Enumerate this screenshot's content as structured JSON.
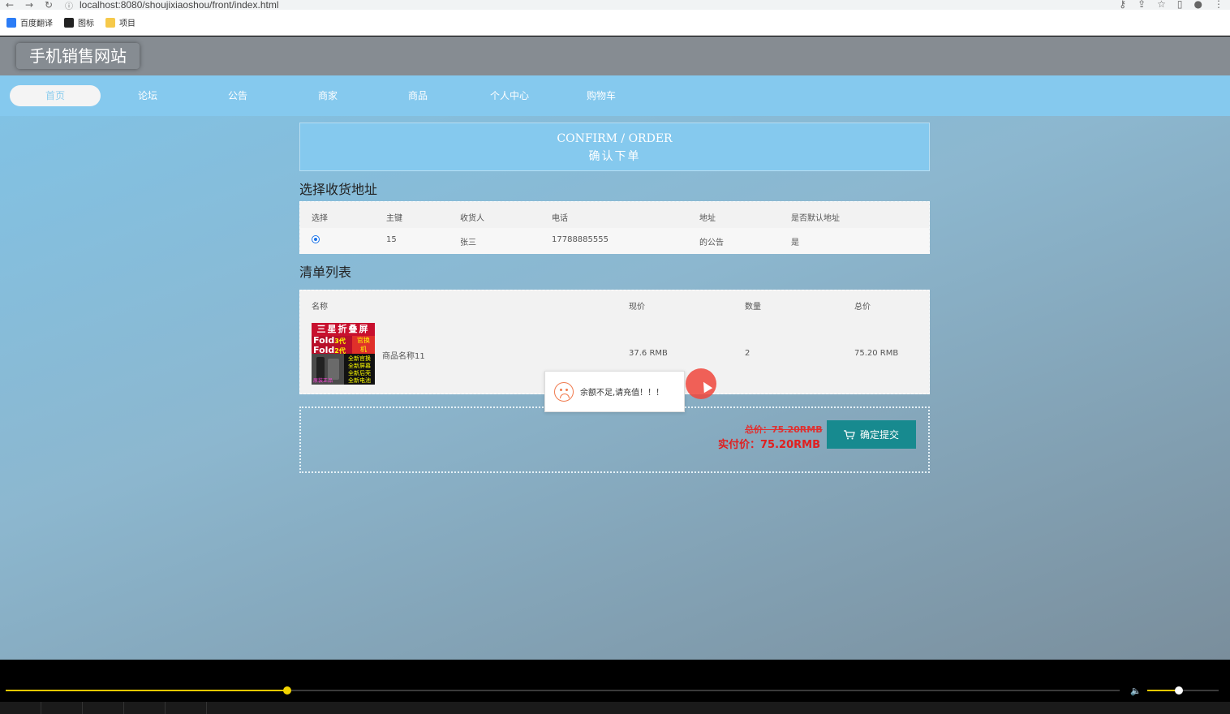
{
  "browser": {
    "url": "localhost:8080/shoujixiaoshou/front/index.html",
    "bookmarks": [
      {
        "label": "百度翻译",
        "icon": "translate-icon",
        "color": "#2b7cf6"
      },
      {
        "label": "图标",
        "icon": "image-icon",
        "color": "#222222"
      },
      {
        "label": "项目",
        "icon": "folder-icon",
        "color": "#f6c94a"
      }
    ]
  },
  "site": {
    "logo": "手机销售网站",
    "nav": [
      "首页",
      "论坛",
      "公告",
      "商家",
      "商品",
      "个人中心",
      "购物车"
    ],
    "active_nav": "首页"
  },
  "confirm": {
    "title_en": "CONFIRM / ORDER",
    "title_cn": "确认下单"
  },
  "address": {
    "section_title": "选择收货地址",
    "headers": [
      "选择",
      "主键",
      "收货人",
      "电话",
      "地址",
      "是否默认地址"
    ],
    "rows": [
      {
        "selected": true,
        "id": "15",
        "name": "张三",
        "phone": "17788885555",
        "address": "的公告",
        "default": "是"
      }
    ]
  },
  "order_list": {
    "section_title": "清单列表",
    "headers": [
      "名称",
      "现价",
      "数量",
      "总价"
    ],
    "items": [
      {
        "name": "商品名称11",
        "price": "37.6 RMB",
        "quantity": "2",
        "total": "75.20 RMB",
        "image_text": {
          "line1": "三星折叠屏",
          "line2a": "Fold",
          "line2b": "Fold",
          "tag1": "3代",
          "tag2": "2代",
          "tag3": "官换",
          "tag4": "机",
          "line3": "全新官换\n全新屏幕\n全新后壳\n全新电池",
          "line4": "原装正品"
        }
      }
    ]
  },
  "summary": {
    "original_total": "总价：75.20RMB",
    "actual_total": "实付价：75.20RMB",
    "submit_label": "确定提交"
  },
  "toast": {
    "message": "余额不足,请充值！！！"
  },
  "player": {
    "progress": 0.253,
    "volume": 0.44
  }
}
